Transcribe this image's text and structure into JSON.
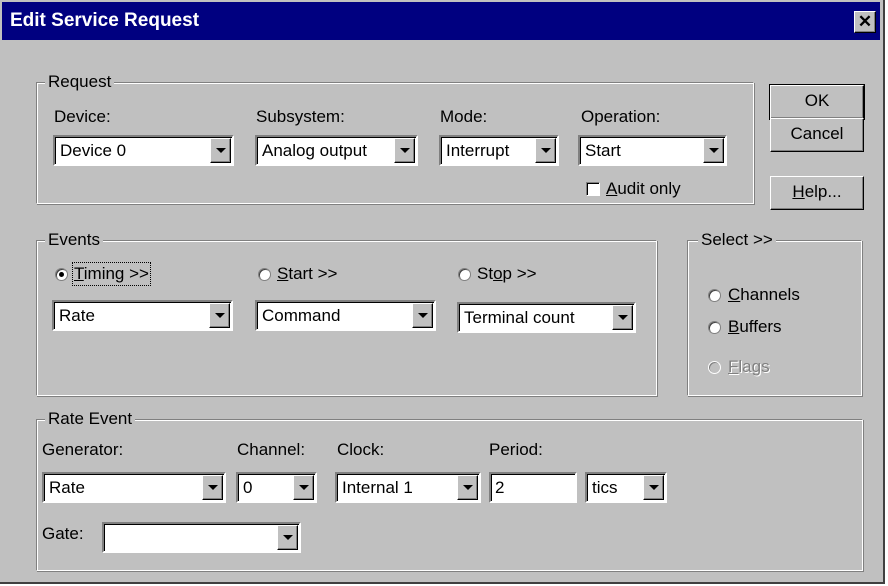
{
  "window": {
    "title": "Edit Service Request",
    "close_label": "✕"
  },
  "request": {
    "legend": "Request",
    "device": {
      "label": "Device:",
      "value": "Device 0"
    },
    "subsystem": {
      "label": "Subsystem:",
      "value": "Analog output"
    },
    "mode": {
      "label": "Mode:",
      "value": "Interrupt"
    },
    "operation": {
      "label": "Operation:",
      "value": "Start"
    },
    "audit_only": {
      "label_pre": "",
      "label_u": "A",
      "label_post": "udit only",
      "checked": false
    }
  },
  "buttons": {
    "ok": "OK",
    "cancel": "Cancel",
    "help_u": "H",
    "help_post": "elp..."
  },
  "events": {
    "legend": "Events",
    "timing": {
      "label_u": "T",
      "label_post": "iming >>",
      "selected": true,
      "value": "Rate"
    },
    "start": {
      "label_u": "S",
      "label_post": "tart >>",
      "selected": false,
      "value": "Command"
    },
    "stop": {
      "label_pre": "St",
      "label_u": "o",
      "label_post": "p >>",
      "selected": false,
      "value": "Terminal count"
    }
  },
  "select": {
    "legend": "Select >>",
    "channels": {
      "label_u": "C",
      "label_post": "hannels"
    },
    "buffers": {
      "label_u": "B",
      "label_post": "uffers"
    },
    "flags": {
      "label_u": "F",
      "label_post": "lags",
      "enabled": false
    }
  },
  "rate_event": {
    "legend": "Rate Event",
    "generator": {
      "label": "Generator:",
      "value": "Rate"
    },
    "channel": {
      "label": "Channel:",
      "value": "0"
    },
    "clock": {
      "label": "Clock:",
      "value": "Internal 1"
    },
    "period": {
      "label": "Period:",
      "value": "2",
      "unit": "tics"
    },
    "gate": {
      "label": "Gate:",
      "value": ""
    }
  }
}
